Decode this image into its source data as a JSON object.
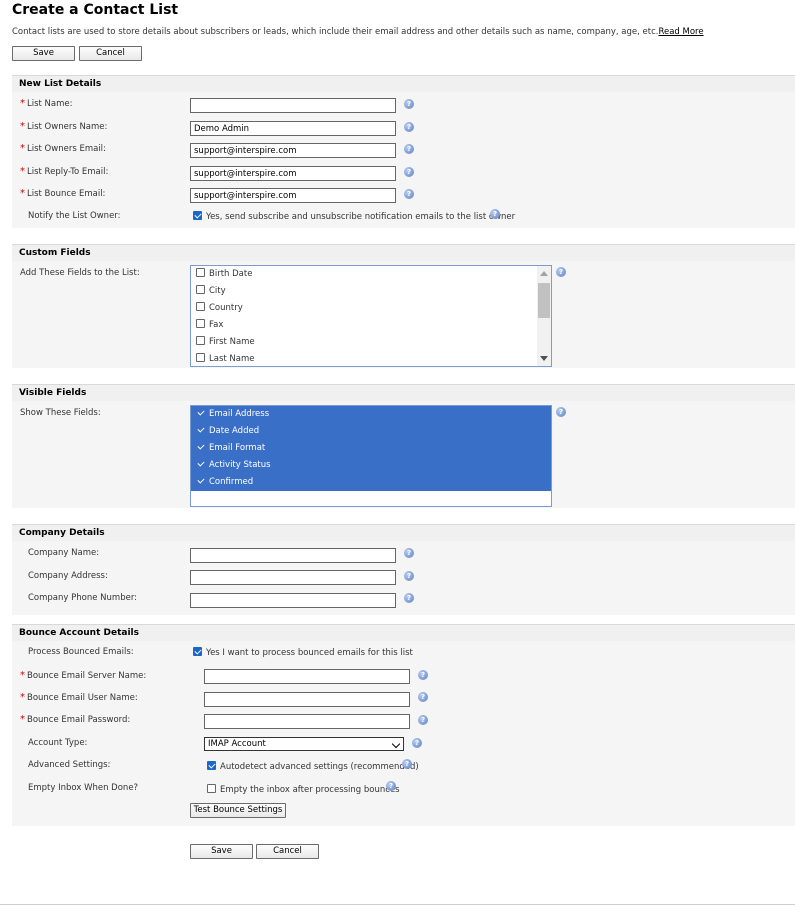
{
  "page": {
    "title": "Create a Contact List",
    "intro": "Contact lists are used to store details about subscribers or leads, which include their email address and other details such as name, company, age, etc.",
    "read_more": "Read More"
  },
  "buttons": {
    "save": "Save",
    "cancel": "Cancel",
    "test_bounce": "Test Bounce Settings"
  },
  "new_list": {
    "heading": "New List Details",
    "list_name_label": "List Name:",
    "list_name_value": "",
    "owner_name_label": "List Owners Name:",
    "owner_name_value": "Demo Admin",
    "owner_email_label": "List Owners Email:",
    "owner_email_value": "support@interspire.com",
    "reply_to_label": "List Reply-To Email:",
    "reply_to_value": "support@interspire.com",
    "bounce_email_label": "List Bounce Email:",
    "bounce_email_value": "support@interspire.com",
    "notify_label": "Notify the List Owner:",
    "notify_text": "Yes, send subscribe and unsubscribe notification emails to the list owner",
    "notify_checked": true
  },
  "custom_fields": {
    "heading": "Custom Fields",
    "label": "Add These Fields to the List:",
    "items": [
      "Birth Date",
      "City",
      "Country",
      "Fax",
      "First Name",
      "Last Name"
    ]
  },
  "visible_fields": {
    "heading": "Visible Fields",
    "label": "Show These Fields:",
    "items": [
      "Email Address",
      "Date Added",
      "Email Format",
      "Activity Status",
      "Confirmed"
    ]
  },
  "company": {
    "heading": "Company Details",
    "name_label": "Company Name:",
    "address_label": "Company Address:",
    "phone_label": "Company Phone Number:"
  },
  "bounce": {
    "heading": "Bounce Account Details",
    "process_label": "Process Bounced Emails:",
    "process_text": "Yes I want to process bounced emails for this list",
    "server_label": "Bounce Email Server Name:",
    "user_label": "Bounce Email User Name:",
    "password_label": "Bounce Email Password:",
    "account_type_label": "Account Type:",
    "account_type_value": "IMAP Account",
    "advanced_label": "Advanced Settings:",
    "advanced_text": "Autodetect advanced settings (recommended)",
    "empty_inbox_label": "Empty Inbox When Done?",
    "empty_inbox_text": "Empty the inbox after processing bounces"
  },
  "colors": {
    "required": "#cc0000",
    "selection": "#3a6fc8",
    "help_icon": "#5b7fc2"
  }
}
